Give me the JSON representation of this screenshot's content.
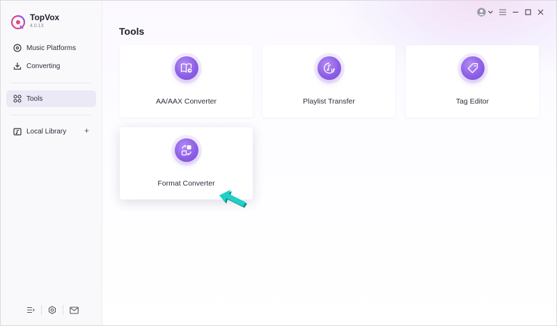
{
  "app": {
    "name": "TopVox",
    "version": "4.0.13"
  },
  "sidebar": {
    "items": [
      {
        "label": "Music Platforms",
        "icon": "music-disc-icon"
      },
      {
        "label": "Converting",
        "icon": "download-icon"
      },
      {
        "label": "Tools",
        "icon": "grid-icon",
        "active": true
      },
      {
        "label": "Local Library",
        "icon": "folder-music-icon",
        "action": "+"
      }
    ],
    "bottom_icons": [
      "queue-list-icon",
      "settings-icon",
      "mail-icon"
    ]
  },
  "window_controls": [
    "user-avatar-icon",
    "chevron-down-icon",
    "menu-icon",
    "minimize-icon",
    "maximize-icon",
    "close-icon"
  ],
  "main": {
    "title": "Tools",
    "tools": [
      {
        "label": "AA/AAX Converter",
        "icon": "book-convert-icon"
      },
      {
        "label": "Playlist Transfer",
        "icon": "music-transfer-icon"
      },
      {
        "label": "Tag Editor",
        "icon": "tag-icon"
      },
      {
        "label": "Format Converter",
        "icon": "format-convert-icon",
        "highlighted": true
      }
    ]
  },
  "colors": {
    "accent": "#8d5fe6",
    "pointer": "#1fc8c0",
    "active_bg": "#ebe9f6"
  }
}
